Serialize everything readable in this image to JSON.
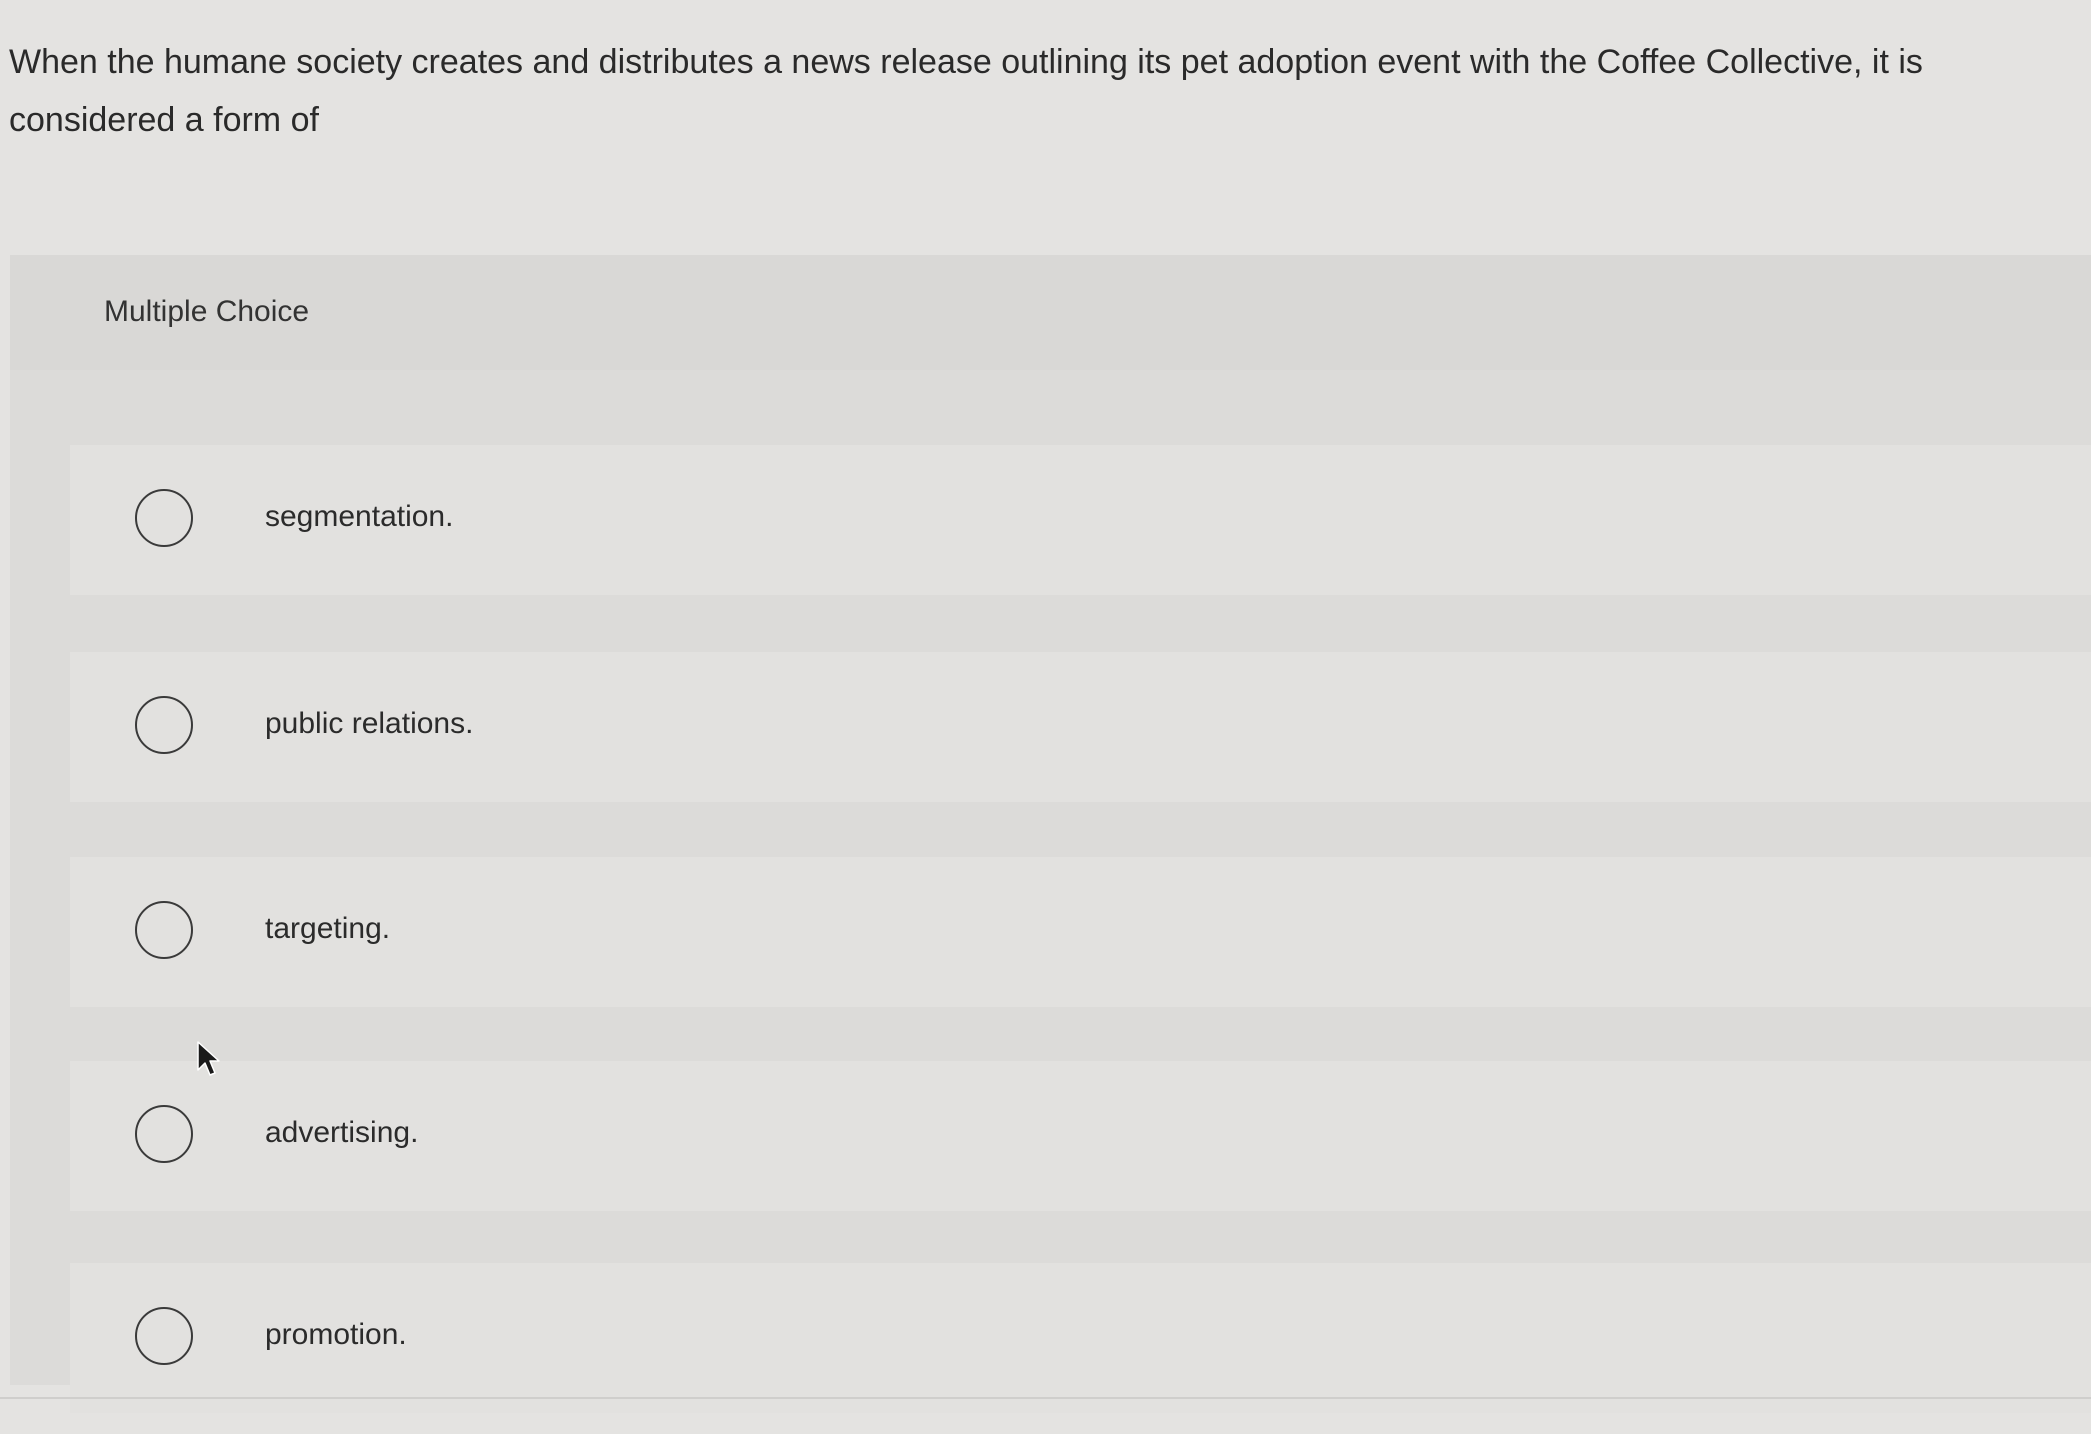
{
  "question": {
    "text": "When the humane society creates and distributes a news release outlining its pet adoption event with the Coffee Collective, it is considered a form of"
  },
  "multiple_choice": {
    "label": "Multiple Choice",
    "options": [
      {
        "label": "segmentation."
      },
      {
        "label": "public relations."
      },
      {
        "label": "targeting."
      },
      {
        "label": "advertising."
      },
      {
        "label": "promotion."
      }
    ]
  },
  "icons": {
    "radio": "radio-unselected-icon",
    "cursor": "mouse-pointer-icon"
  }
}
